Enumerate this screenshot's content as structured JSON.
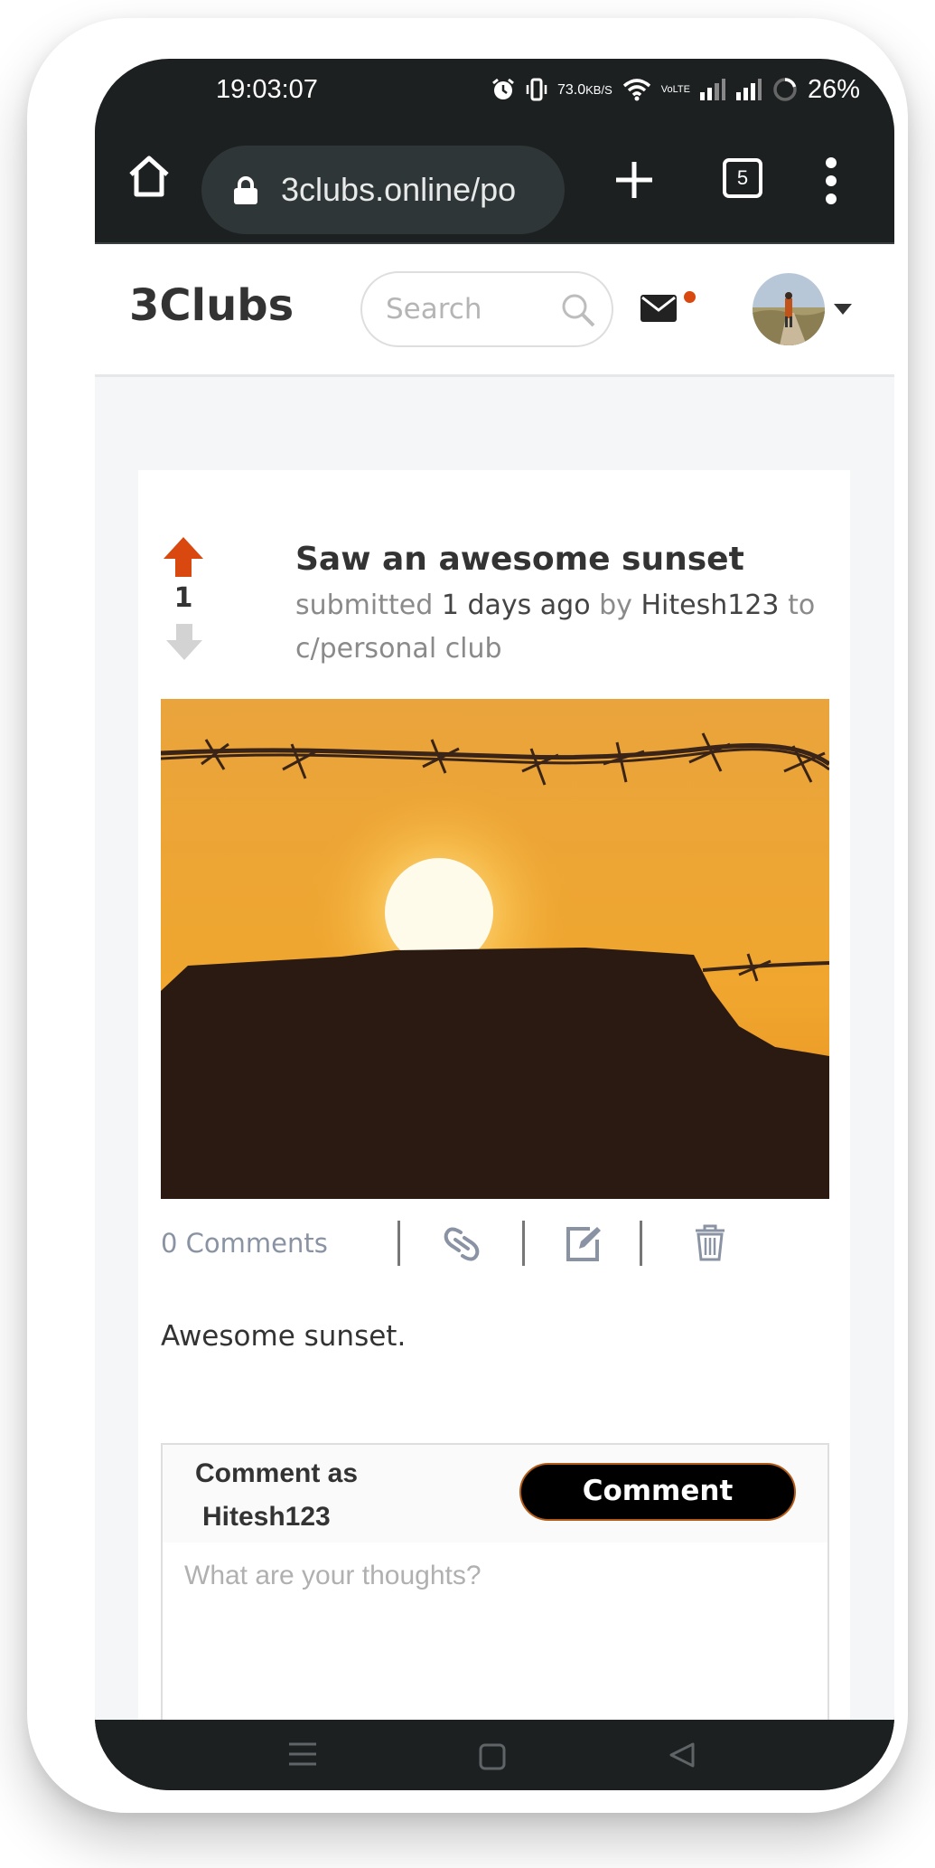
{
  "status_bar": {
    "time": "19:03:07",
    "net_speed_value": "73.0",
    "net_speed_unit": "KB/S",
    "volte_top": "Vo",
    "volte_bottom": "LTE",
    "battery": "26%",
    "icons": [
      "alarm-icon",
      "vibrate-icon",
      "wifi-icon",
      "volte-icon",
      "signal-icon",
      "signal-icon",
      "battery-icon"
    ]
  },
  "browser": {
    "url": "3clubs.online/po",
    "tab_count": "5",
    "icons": [
      "home-icon",
      "lock-icon",
      "plus-icon",
      "tabs-icon",
      "more-vert-icon"
    ]
  },
  "header": {
    "logo": "3Clubs",
    "search_placeholder": "Search",
    "icons": [
      "search-icon",
      "mail-icon",
      "avatar",
      "caret-down-icon"
    ]
  },
  "post": {
    "vote_count": "1",
    "title": "Saw an awesome sunset",
    "meta": {
      "prefix": "submitted",
      "age": "1 days ago",
      "by": "by",
      "author": "Hitesh123",
      "to": "to",
      "club": "c/personal club"
    },
    "comments_link": "0 Comments",
    "body": "Awesome sunset.",
    "action_icons": [
      "link-icon",
      "edit-icon",
      "trash-icon"
    ]
  },
  "comment_form": {
    "label_line1": "Comment as",
    "label_line2": "Hitesh123",
    "button": "Comment",
    "placeholder": "What are your thoughts?"
  },
  "nav_bar": {
    "icons": [
      "menu-icon",
      "home-square-icon",
      "back-icon"
    ]
  },
  "colors": {
    "accent": "#d9480f",
    "dark": "#1c2021",
    "muted": "#8a93a3"
  }
}
